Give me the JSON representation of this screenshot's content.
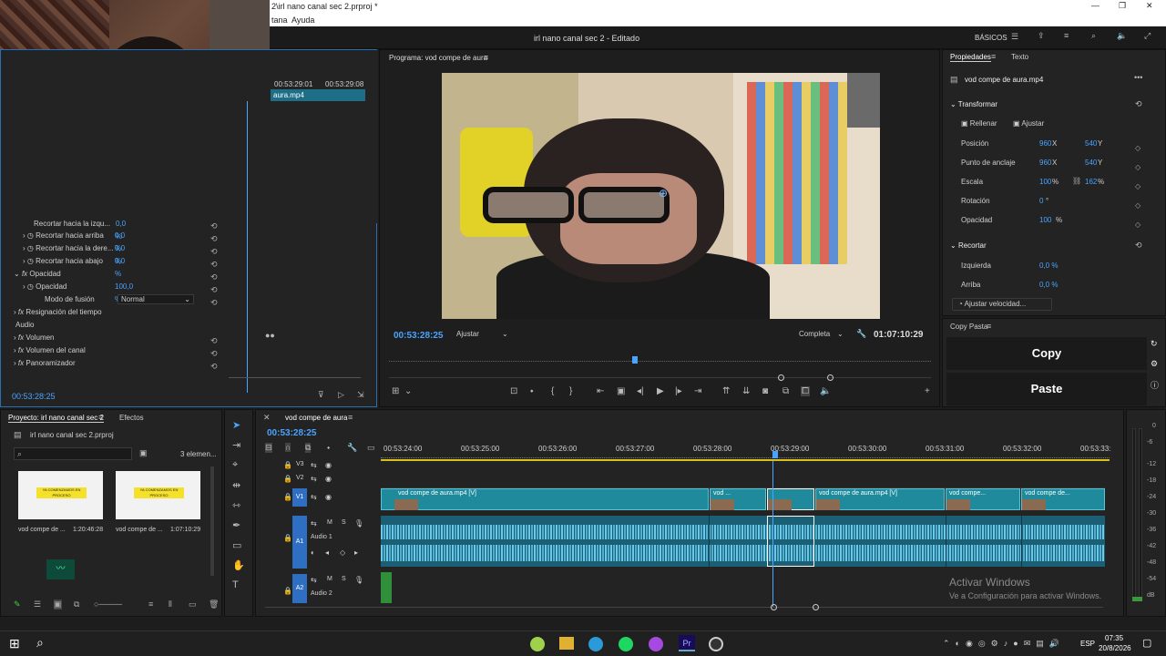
{
  "titlebar": {
    "title": "2\\irl nano canal sec 2.prproj *",
    "min": "—",
    "max": "❐",
    "close": "✕"
  },
  "menu": {
    "items": [
      "tana",
      "Ayuda"
    ]
  },
  "appbar": {
    "project_title": "irl nano canal sec 2 - Editado",
    "workspace": "BÁSICOS"
  },
  "source_panel": {
    "times": [
      "00:53:29:01",
      "00:53:29:08"
    ],
    "clip_label": "aura.mp4",
    "footer_time": "00:53:28:25"
  },
  "effects_rows": [
    {
      "name": "Recortar hacia la izqu...",
      "value": "0,0 %"
    },
    {
      "name": "Recortar hacia arriba",
      "value": "0,0 %"
    },
    {
      "name": "Recortar hacia la dere...",
      "value": "0,0 %"
    },
    {
      "name": "Recortar hacia abajo",
      "value": "0,0 %"
    },
    {
      "name": "Opacidad",
      "value": ""
    },
    {
      "name": "Opacidad",
      "value": "100,0 %"
    },
    {
      "name": "Modo de fusión",
      "value": "Normal"
    },
    {
      "name": "Resignación del tiempo",
      "value": ""
    },
    {
      "name": "Audio",
      "value": ""
    },
    {
      "name": "Volumen",
      "value": ""
    },
    {
      "name": "Volumen del canal",
      "value": ""
    },
    {
      "name": "Panoramizador",
      "value": ""
    }
  ],
  "program": {
    "title": "Programa: vod compe de aura",
    "current_time": "00:53:28:25",
    "fit": "Ajustar",
    "quality": "Completa",
    "duration": "01:07:10:29"
  },
  "properties": {
    "tab": "Propiedades",
    "tab2": "Texto",
    "clip": "vod compe de aura.mp4",
    "transform": "Transformar",
    "fill": "Rellenar",
    "fit": "Ajustar",
    "rows": [
      {
        "label": "Posición",
        "v1": "960",
        "u1": "X",
        "v2": "540",
        "u2": "Y"
      },
      {
        "label": "Punto de anclaje",
        "v1": "960",
        "u1": "X",
        "v2": "540",
        "u2": "Y"
      },
      {
        "label": "Escala",
        "v1": "100",
        "u1": "%",
        "v2": "162",
        "u2": "%"
      },
      {
        "label": "Rotación",
        "v1": "0",
        "u1": "°",
        "v2": "",
        "u2": ""
      },
      {
        "label": "Opacidad",
        "v1": "100",
        "u1": "%",
        "v2": "",
        "u2": ""
      }
    ],
    "crop": "Recortar",
    "crop_rows": [
      {
        "label": "Izquierda",
        "value": "0,0 %"
      },
      {
        "label": "Arriba",
        "value": "0,0 %"
      }
    ],
    "speed": "Ajustar velocidad..."
  },
  "copypaste": {
    "title": "Copy Pasta",
    "copy": "Copy",
    "paste": "Paste"
  },
  "project": {
    "tab": "Proyecto: irl nano canal sec 2",
    "tab2": "Efectos",
    "file": "irl nano canal sec 2.prproj",
    "count": "3 elemen...",
    "items": [
      {
        "name": "vod compe de ...",
        "dur": "1:20:46:28",
        "thumb_text": "YA COMENZAMOS EN PROCESO"
      },
      {
        "name": "vod compe de ...",
        "dur": "1:07:10:29",
        "thumb_text": "YA COMENZAMOS EN PROCESO"
      }
    ]
  },
  "timeline": {
    "tab": "vod compe de aura",
    "time": "00:53:28:25",
    "ruler": [
      "00:53:24:00",
      "00:53:25:00",
      "00:53:26:00",
      "00:53:27:00",
      "00:53:28:00",
      "00:53:29:00",
      "00:53:30:00",
      "00:53:31:00",
      "00:53:32:00",
      "00:53:33:"
    ],
    "tracks": {
      "v3": "V3",
      "v2": "V2",
      "v1": "V1",
      "a1": "A1",
      "a1_name": "Audio 1",
      "a2": "A2",
      "a2_name": "Audio 2"
    },
    "clips": [
      "vod compe de aura.mp4 [V]",
      "vod ...",
      "vod compe de aura.mp4 [V]",
      "vod compe...",
      "vod compe de..."
    ],
    "meter": [
      "0",
      "-6",
      "-12",
      "-18",
      "-24",
      "-30",
      "-36",
      "-42",
      "-48",
      "-54",
      "dB"
    ]
  },
  "activate": {
    "title": "Activar Windows",
    "sub": "Ve a Configuración para activar Windows."
  },
  "taskbar": {
    "lang": "ESP",
    "time": "07:35",
    "date": "20/8/2026"
  },
  "colors": {
    "accent": "#4aa3ff",
    "clip": "#1f8a9c",
    "audio": "#3fa6c6",
    "panel": "#232323"
  }
}
